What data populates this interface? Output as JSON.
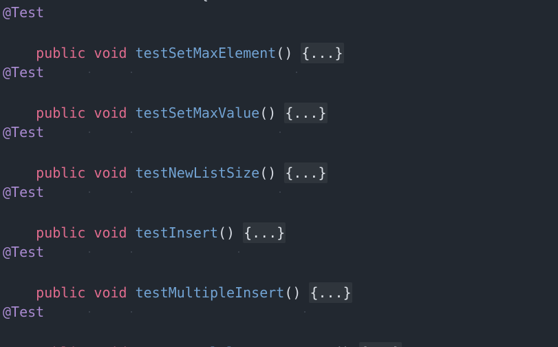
{
  "top_fragment": "{",
  "tokens": {
    "annotation": "@Test",
    "public": "public",
    "void": "void",
    "parens": "()",
    "fold": "{...}"
  },
  "methods": [
    "testSetMaxElement",
    "testSetMaxValue",
    "testNewListSize",
    "testInsert",
    "testMultipleInsert",
    "testNormalElementsReport"
  ],
  "colors": {
    "background": "#222830",
    "annotation": "#a98ad0",
    "keyword": "#e06c8e",
    "method": "#72a3d3",
    "fold_background": "#2f353c"
  }
}
